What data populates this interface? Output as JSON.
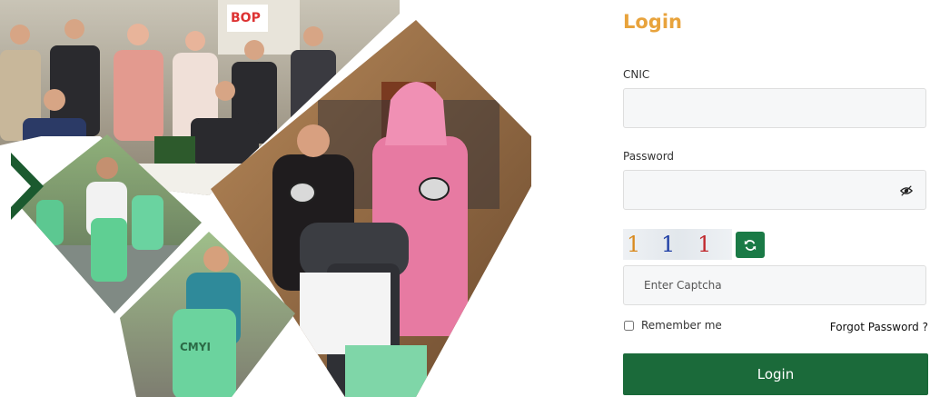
{
  "form": {
    "title": "Login",
    "cnic_label": "CNIC",
    "cnic_value": "",
    "password_label": "Password",
    "password_value": "",
    "captcha_chars": [
      "1",
      "1",
      "1"
    ],
    "captcha_placeholder": "Enter Captcha",
    "remember_label": "Remember me",
    "remember_checked": false,
    "forgot_label": "Forgot Password ?",
    "submit_label": "Login"
  },
  "icons": {
    "password_toggle": "eye-icon",
    "captcha_refresh": "refresh-icon"
  },
  "collage": {
    "banner_text": "BOP",
    "scooter_text": "CMYI"
  },
  "colors": {
    "title_accent": "#e8a33c",
    "brand_green": "#1b6a3a",
    "refresh_green": "#1a7a46",
    "captcha_char_1": "#d98a1f",
    "captcha_char_2": "#1f3fa5",
    "captcha_char_3": "#c0282d"
  }
}
